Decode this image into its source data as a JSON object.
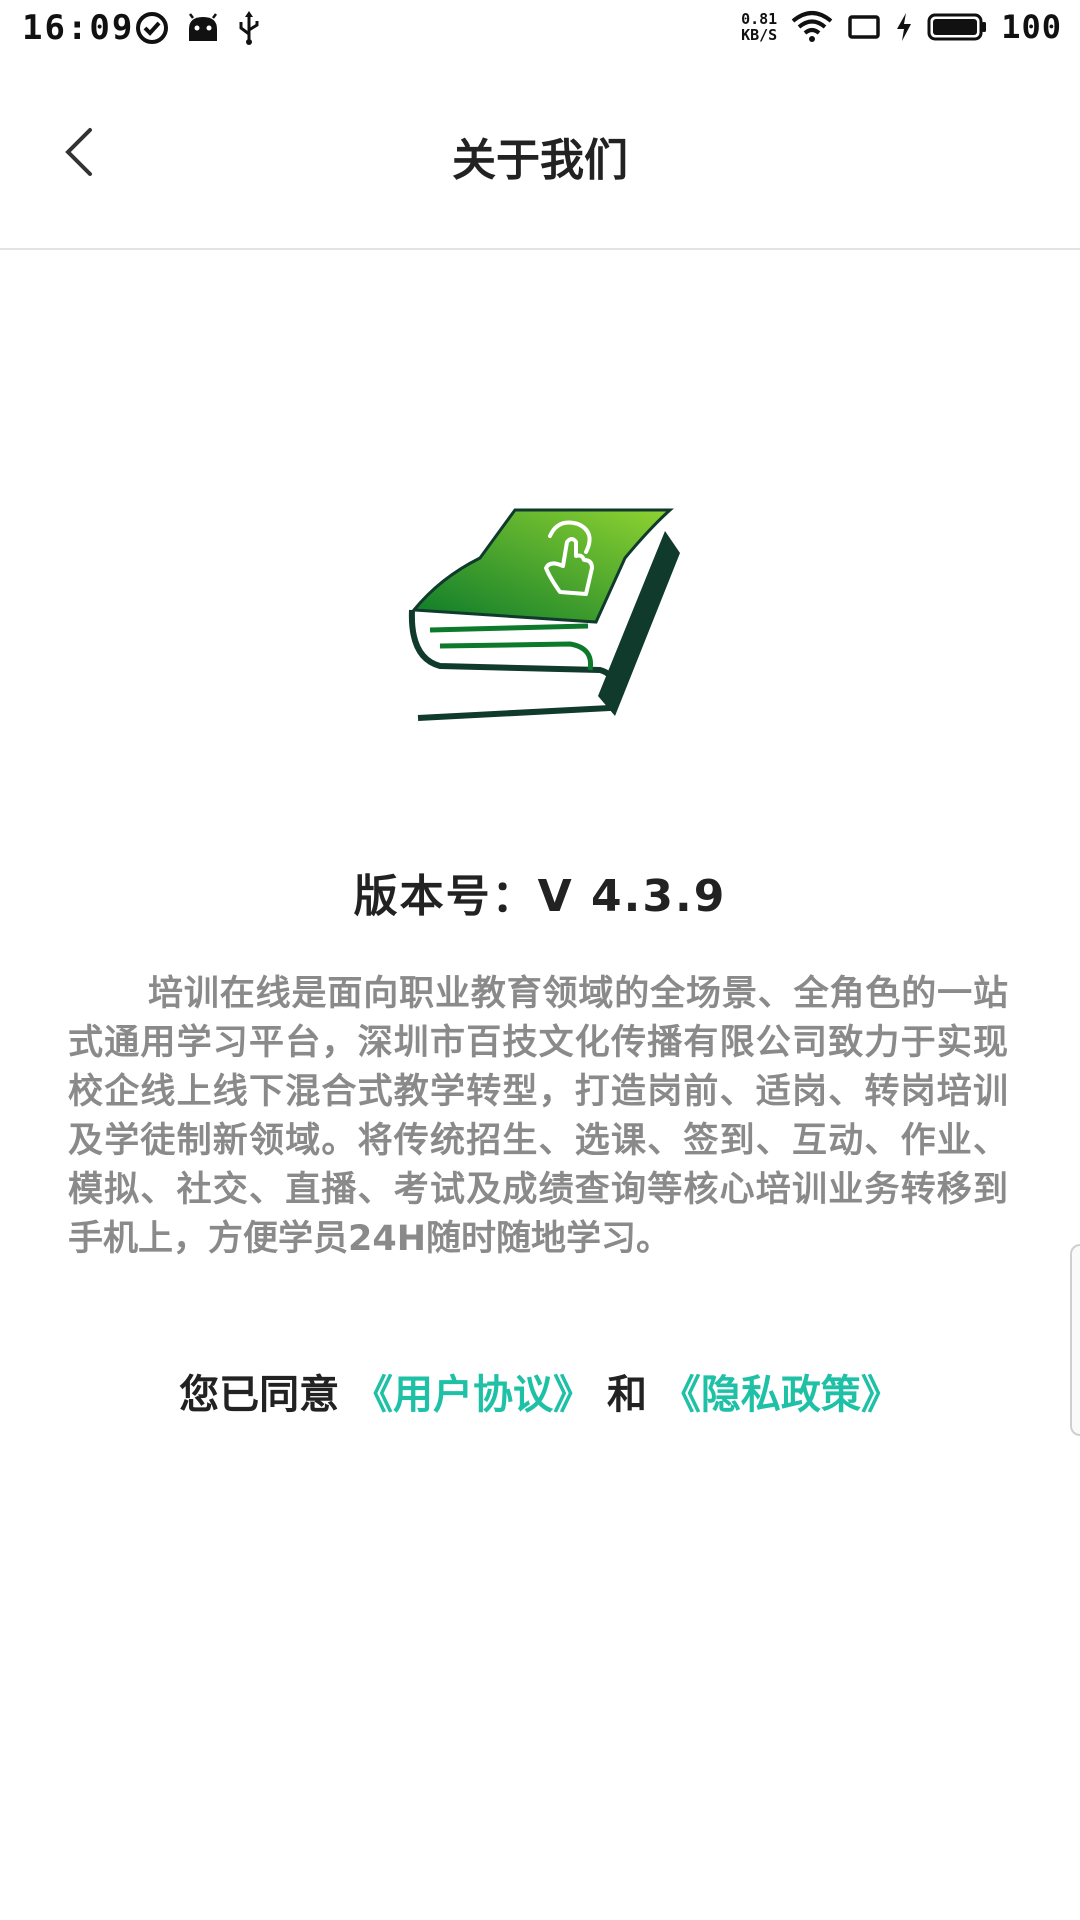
{
  "status_bar": {
    "time": "16:09",
    "net_speed_value": "0.81",
    "net_speed_unit": "KB/S",
    "battery_level": "100"
  },
  "header": {
    "title": "关于我们",
    "back_icon": "chevron-left-icon"
  },
  "logo": {
    "icon": "green-book-logo",
    "colors": {
      "cover_light": "#8fd331",
      "cover_dark": "#0c7a2a",
      "spine": "#0f3a2c"
    }
  },
  "about": {
    "version_text": "版本号：V 4.3.9",
    "description": "培训在线是面向职业教育领域的全场景、全角色的一站式通用学习平台，深圳市百技文化传播有限公司致力于实现校企线上线下混合式教学转型，打造岗前、适岗、转岗培训及学徒制新领域。将传统招生、选课、签到、互动、作业、模拟、社交、直播、考试及成绩查询等核心培训业务转移到手机上，方便学员24H随时随地学习。"
  },
  "agreement": {
    "prefix": "您已同意",
    "user_agreement": "《用户协议》",
    "conjunction": "和",
    "privacy_policy": "《隐私政策》",
    "link_color": "#1fc1a6"
  }
}
